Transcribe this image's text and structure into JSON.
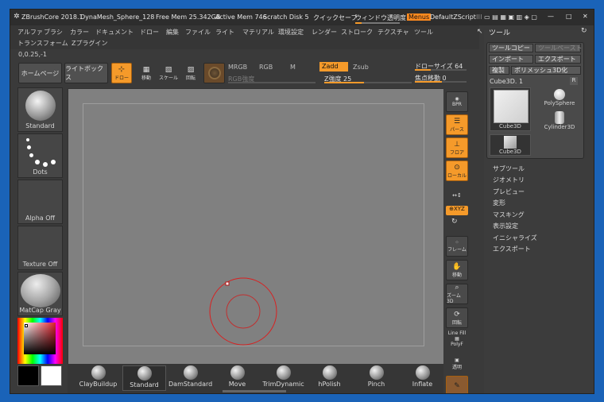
{
  "titlebar": {
    "app": "ZBrushCore 2018.1",
    "doc": "DynaMesh_Sphere_128",
    "free_mem": "Free Mem 25.342GB",
    "active_mem": "Active Mem 746",
    "scratch": "Scratch Disk 5",
    "quicksave": "クイックセーブ",
    "transparency": "ウィンドウ透明度",
    "menus": "Menus",
    "default_script": "DefaultZScript"
  },
  "menubar": {
    "row1": [
      "アルファ",
      "ブラシ",
      "カラー",
      "ドキュメント",
      "ドロー",
      "編集",
      "ファイル",
      "ライト",
      "マテリアル",
      "環境設定",
      "レンダー",
      "ストローク",
      "テクスチャ",
      "ツール"
    ],
    "row2": [
      "トランスフォーム",
      "Zプラグイン"
    ]
  },
  "coords": "0,0.25,-1",
  "topbar": {
    "home": "ホームページ",
    "lightbox": "ライトボックス",
    "draw": "ドロー",
    "move": "移動",
    "scale": "スケール",
    "rotate": "回転",
    "mrgb": "MRGB",
    "rgb": "RGB",
    "m": "M",
    "zadd": "Zadd",
    "zsub": "Zsub",
    "rgb_intensity": "RGB強度",
    "z_intensity": "Z強度 25",
    "draw_size": "ドローサイズ 64",
    "focal_shift": "焦点移動 0"
  },
  "left_slots": [
    {
      "label": "Standard"
    },
    {
      "label": "Dots"
    },
    {
      "label": "Alpha Off"
    },
    {
      "label": "Texture Off"
    },
    {
      "label": "MatCap Gray"
    }
  ],
  "brushes": [
    "ClayBuildup",
    "Standard",
    "DamStandard",
    "Move",
    "TrimDynamic",
    "hPolish",
    "Pinch",
    "Inflate"
  ],
  "right_tools": {
    "bpr": "BPR",
    "persp": "パース",
    "floor": "フロア",
    "local": "ローカル",
    "xyz": "⊕XYZ",
    "frame": "フレーム",
    "move": "移動",
    "zoom": "ズーム3D",
    "rotate": "回転",
    "linefill": "Line Fill",
    "polyf": "PolyF",
    "transp": "透明"
  },
  "tool_panel": {
    "title": "ツール",
    "copy_tool": "ツールコピー",
    "paste_tool": "ツールペースト",
    "import": "インポート",
    "export": "エクスポート",
    "clone": "複製",
    "polymesh": "ポリメッシュ3D化",
    "current": "Cube3D. 1",
    "r": "R",
    "thumbs": [
      "Cube3D",
      "PolySphere",
      "Cylinder3D",
      "Cube3D"
    ],
    "sections": [
      "サブツール",
      "ジオメトリ",
      "プレビュー",
      "変形",
      "マスキング",
      "表示設定",
      "イニシャライズ",
      "エクスポート"
    ]
  },
  "colors": {
    "accent": "#f59a2a",
    "desktop": "#1a63b8",
    "cursor": "#d92020"
  }
}
